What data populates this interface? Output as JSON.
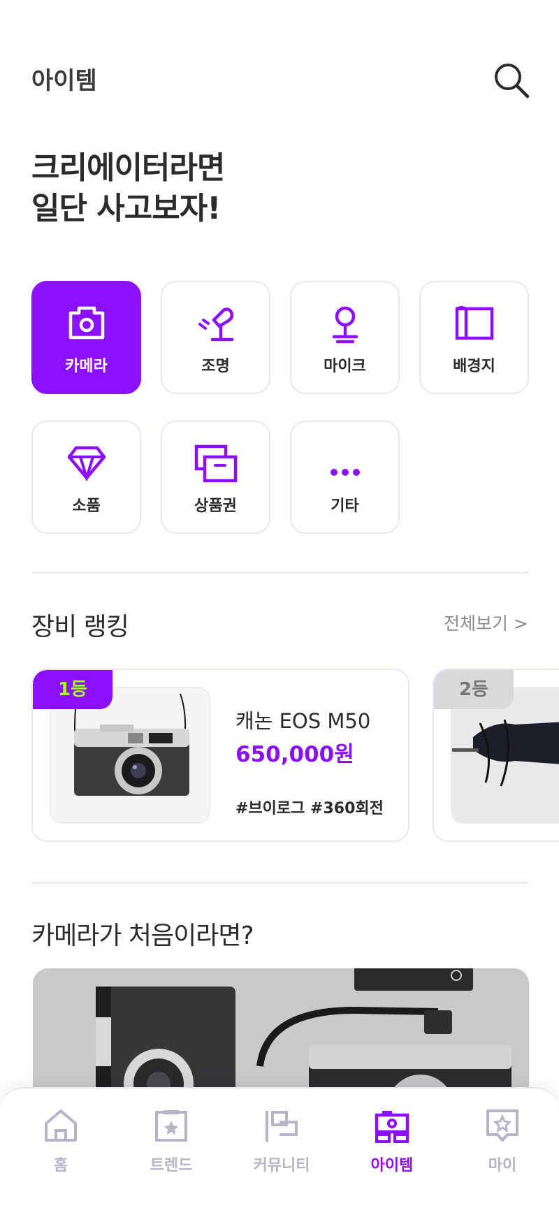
{
  "header": {
    "title": "아이템",
    "search_icon": "search-icon"
  },
  "headline": {
    "line1": "크리에이터라면",
    "line2": "일단 사고보자!"
  },
  "categories": [
    {
      "label": "카메라",
      "icon": "camera-icon",
      "active": true
    },
    {
      "label": "조명",
      "icon": "light-icon",
      "active": false
    },
    {
      "label": "마이크",
      "icon": "microphone-icon",
      "active": false
    },
    {
      "label": "배경지",
      "icon": "backdrop-icon",
      "active": false
    },
    {
      "label": "소품",
      "icon": "gem-icon",
      "active": false
    },
    {
      "label": "상품권",
      "icon": "gift-card-icon",
      "active": false
    },
    {
      "label": "기타",
      "icon": "more-icon",
      "active": false
    }
  ],
  "ranking": {
    "title": "장비 랭킹",
    "see_all": "전체보기 >",
    "items": [
      {
        "rank": "1등",
        "name": "캐논 EOS M50",
        "price": "650,000원",
        "tags": "#브이로그 #360회전"
      },
      {
        "rank": "2등"
      }
    ]
  },
  "beginner": {
    "title": "카메라가 처음이라면?"
  },
  "tabbar": {
    "tabs": [
      {
        "label": "홈",
        "icon": "home-icon",
        "active": false
      },
      {
        "label": "트렌드",
        "icon": "trend-icon",
        "active": false
      },
      {
        "label": "커뮤니티",
        "icon": "community-icon",
        "active": false
      },
      {
        "label": "아이템",
        "icon": "item-icon",
        "active": true
      },
      {
        "label": "마이",
        "icon": "my-icon",
        "active": false
      }
    ]
  },
  "colors": {
    "accent": "#8b10ff",
    "rank1_badge": "#8b10ff",
    "rank1_text": "#a6f23c",
    "rank2_badge": "#d9d9d9",
    "inactive": "#b6b4c6"
  }
}
